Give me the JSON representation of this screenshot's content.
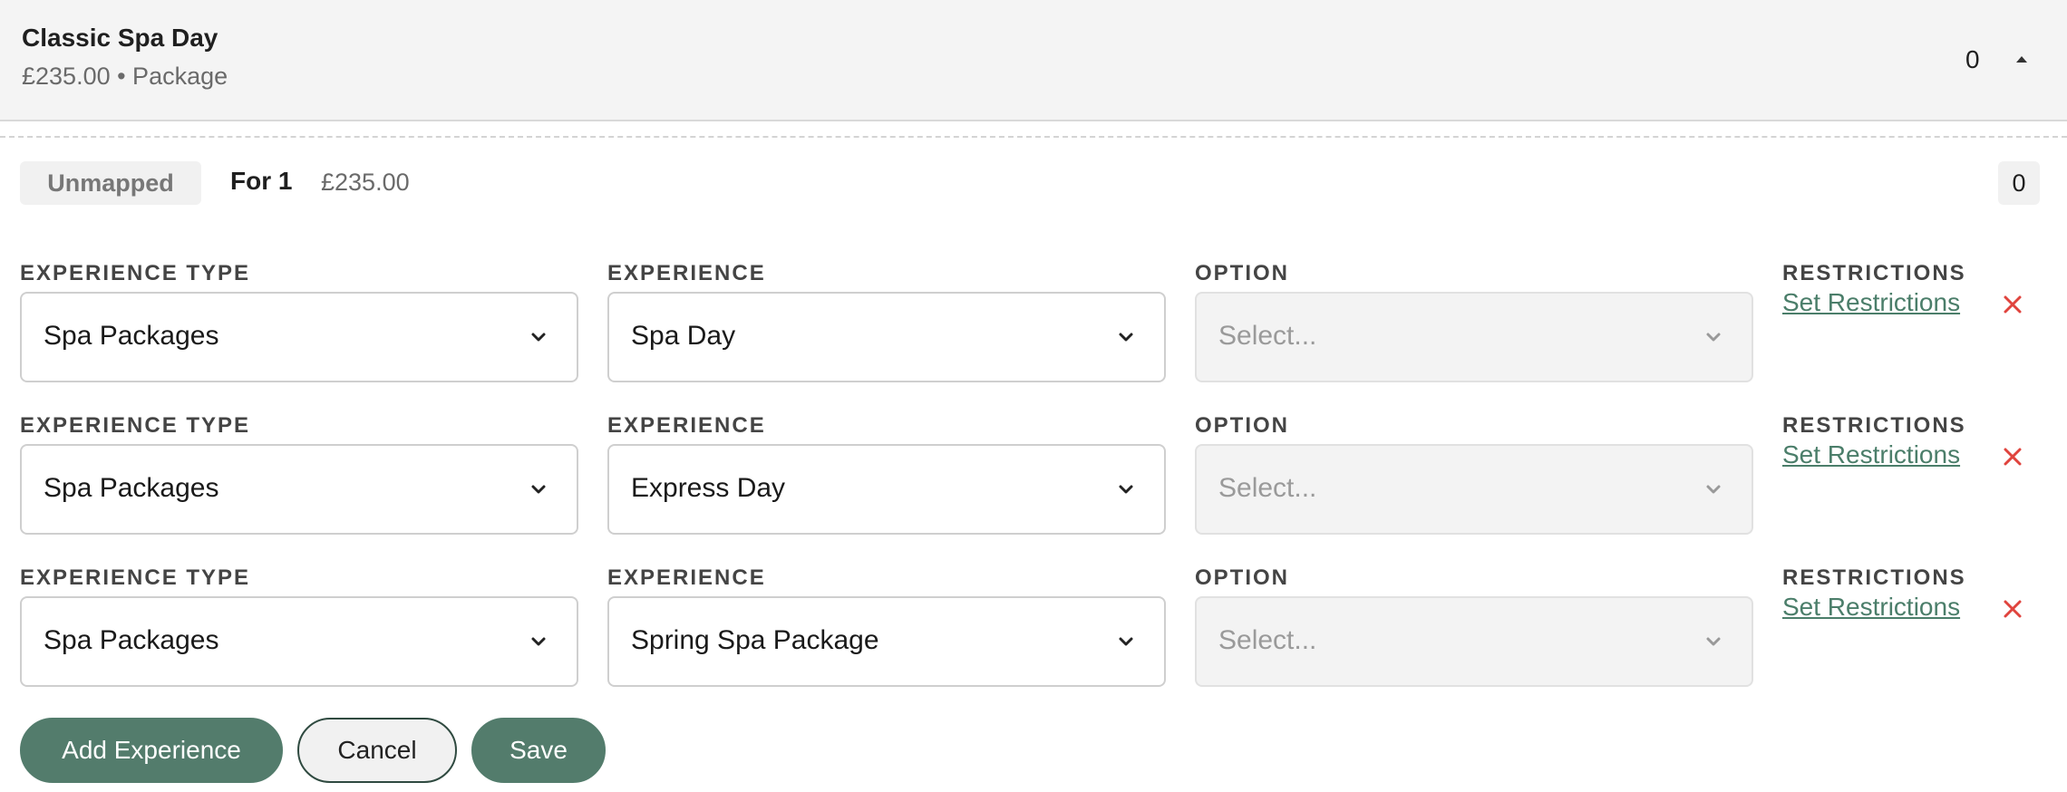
{
  "package": {
    "title": "Classic Spa Day",
    "subtitle": "£235.00 • Package",
    "count": "0"
  },
  "rate": {
    "status": "Unmapped",
    "for_label": "For 1",
    "price": "£235.00",
    "count": "0"
  },
  "labels": {
    "experience_type": "EXPERIENCE TYPE",
    "experience": "EXPERIENCE",
    "option": "OPTION",
    "restrictions": "RESTRICTIONS",
    "set_restrictions": "Set Restrictions"
  },
  "mappings": [
    {
      "experience_type": "Spa Packages",
      "experience": "Spa Day",
      "option_placeholder": "Select..."
    },
    {
      "experience_type": "Spa Packages",
      "experience": "Express Day",
      "option_placeholder": "Select..."
    },
    {
      "experience_type": "Spa Packages",
      "experience": "Spring Spa Package",
      "option_placeholder": "Select..."
    }
  ],
  "buttons": {
    "add_experience": "Add Experience",
    "cancel": "Cancel",
    "save": "Save"
  },
  "colors": {
    "accent": "#537c6c",
    "link": "#4b7e6a",
    "remove": "#e0443e"
  }
}
